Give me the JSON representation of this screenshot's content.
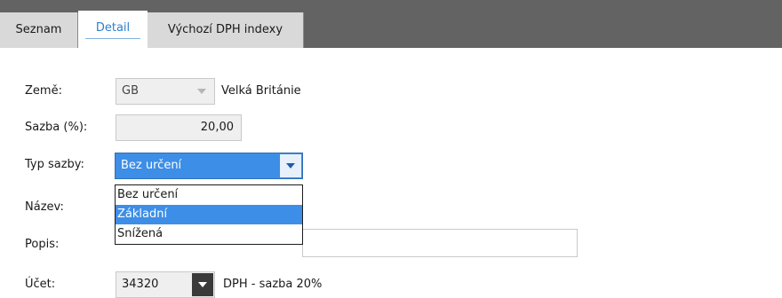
{
  "tabs": [
    {
      "label": "Seznam",
      "active": false
    },
    {
      "label": "Detail",
      "active": true
    },
    {
      "label": "Výchozí DPH indexy",
      "active": false
    }
  ],
  "form": {
    "zeme": {
      "label": "Země:",
      "code": "GB",
      "name": "Velká Británie"
    },
    "sazba": {
      "label": "Sazba (%):",
      "value": "20,00"
    },
    "typ_sazby": {
      "label": "Typ sazby:",
      "selected": "Bez určení",
      "options": [
        "Bez určení",
        "Základní",
        "Snížená"
      ],
      "highlighted_index": 1
    },
    "nazev": {
      "label": "Název:",
      "value": ""
    },
    "popis": {
      "label": "Popis:",
      "value": ""
    },
    "ucet": {
      "label": "Účet:",
      "code": "34320",
      "name": "DPH - sazba 20%"
    }
  },
  "colors": {
    "tabbar": "#636363",
    "active_tab_text": "#2f7fc9",
    "select_blue": "#3d8ee6"
  }
}
